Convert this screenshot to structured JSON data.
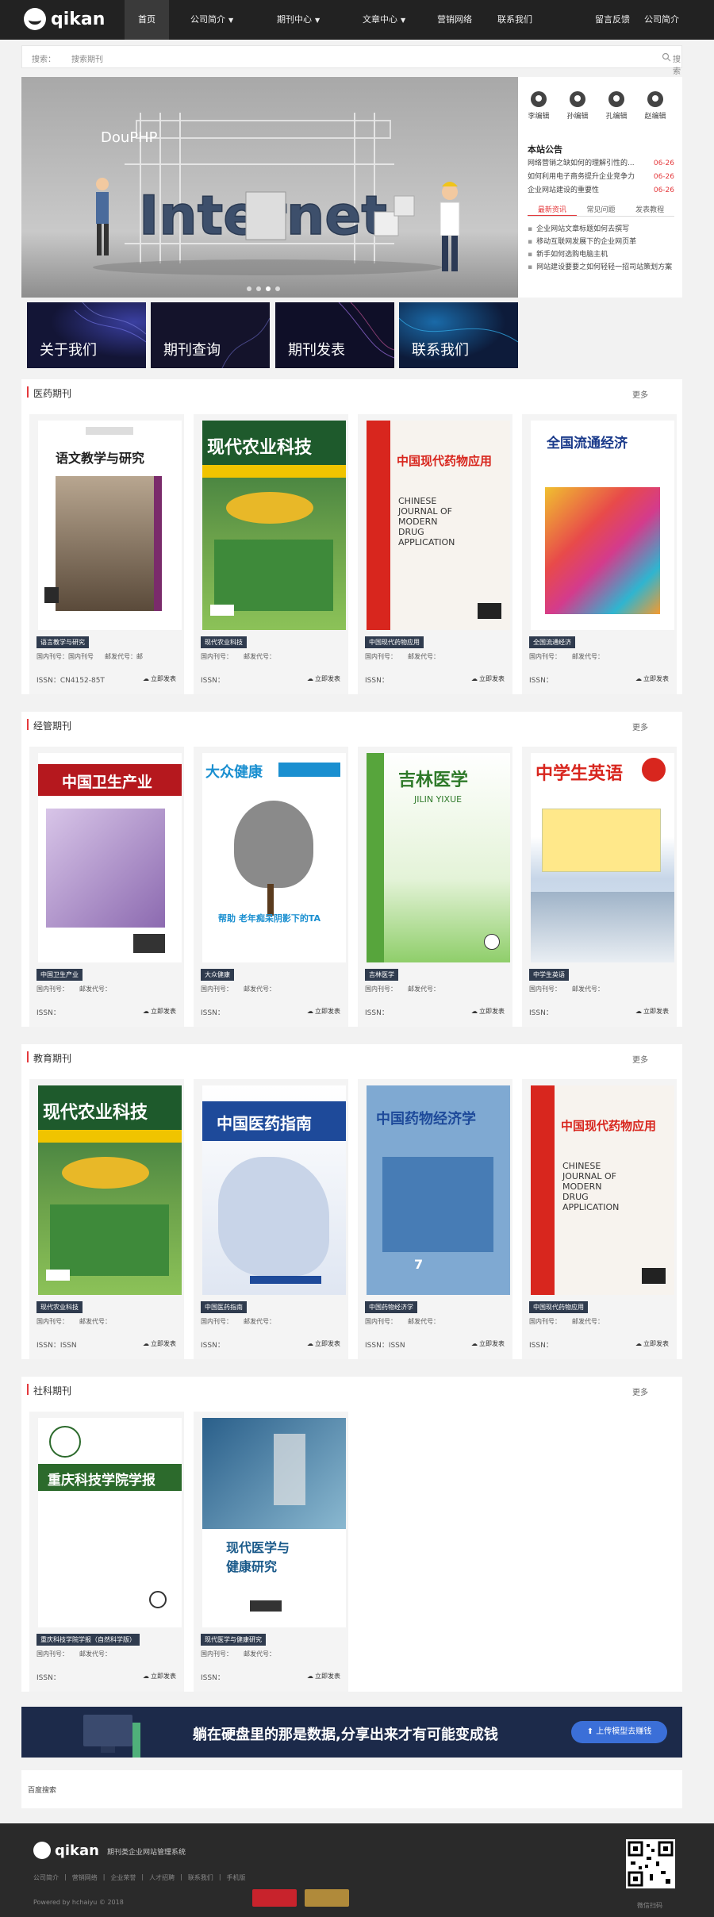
{
  "header": {
    "logo_text": "qikan",
    "nav": [
      {
        "label": "首页",
        "active": true,
        "dropdown": false
      },
      {
        "label": "公司简介",
        "active": false,
        "dropdown": true
      },
      {
        "label": "期刊中心",
        "active": false,
        "dropdown": true
      },
      {
        "label": "文章中心",
        "active": false,
        "dropdown": true
      },
      {
        "label": "营销网络",
        "active": false,
        "dropdown": false
      },
      {
        "label": "联系我们",
        "active": false,
        "dropdown": false
      }
    ],
    "right_links": [
      "留言反馈",
      "公司简介"
    ]
  },
  "search": {
    "label": "搜索：",
    "placeholder": "搜索期刊",
    "button": "搜索"
  },
  "banner": {
    "brand_text": "DouPHP",
    "headline": "Internet",
    "slides": 4,
    "active_slide": 3
  },
  "sidebar": {
    "editors": [
      "李编辑",
      "孙编辑",
      "孔编辑",
      "赵编辑"
    ],
    "notice_title": "本站公告",
    "notices": [
      {
        "text": "网络营销之缺如何的理解引性的...",
        "date": "06-26"
      },
      {
        "text": "如何利用电子商务提升企业竞争力",
        "date": "06-26"
      },
      {
        "text": "企业网站建设的重要性",
        "date": "06-26"
      }
    ],
    "tabs": [
      "最新资讯",
      "常见问题",
      "发表教程"
    ],
    "news": [
      "企业网站文章标题如何去撰写",
      "移动互联网发展下的企业网页革",
      "新手如何选购电脑主机",
      "网站建设要要之如何轻轻一招司站策划方案"
    ]
  },
  "category_tiles": [
    "关于我们",
    "期刊查询",
    "期刊发表",
    "联系我们"
  ],
  "sections": [
    {
      "title": "医药期刊",
      "more": "更多",
      "cards": [
        {
          "tag": "语言教学与研究",
          "cn_label": "国内刊号：国内刊号",
          "post_label": "邮发代号：邮",
          "issn": "ISSN：CN4152-85T",
          "cover": "yuwen"
        },
        {
          "tag": "现代农业科技",
          "cn_label": "国内刊号：",
          "post_label": "邮发代号：",
          "issn": "ISSN：",
          "cover": "nongye"
        },
        {
          "tag": "中国现代药物应用",
          "cn_label": "国内刊号：",
          "post_label": "邮发代号：",
          "issn": "ISSN：",
          "cover": "yaowu"
        },
        {
          "tag": "全国流通经济",
          "cn_label": "国内刊号：",
          "post_label": "邮发代号：",
          "issn": "ISSN：",
          "cover": "liutong"
        }
      ]
    },
    {
      "title": "经管期刊",
      "more": "更多",
      "cards": [
        {
          "tag": "中国卫生产业",
          "cn_label": "国内刊号：",
          "post_label": "邮发代号：",
          "issn": "ISSN：",
          "cover": "weisheng"
        },
        {
          "tag": "大众健康",
          "cn_label": "国内刊号：",
          "post_label": "邮发代号：",
          "issn": "ISSN：",
          "cover": "jiankang"
        },
        {
          "tag": "吉林医学",
          "cn_label": "国内刊号：",
          "post_label": "邮发代号：",
          "issn": "ISSN：",
          "cover": "jilin"
        },
        {
          "tag": "中学生英语",
          "cn_label": "国内刊号：",
          "post_label": "邮发代号：",
          "issn": "ISSN：",
          "cover": "yingyu"
        }
      ]
    },
    {
      "title": "教育期刊",
      "more": "更多",
      "cards": [
        {
          "tag": "现代农业科技",
          "cn_label": "国内刊号：",
          "post_label": "邮发代号：",
          "issn": "ISSN：ISSN",
          "cover": "nongye"
        },
        {
          "tag": "中国医药指南",
          "cn_label": "国内刊号：",
          "post_label": "邮发代号：",
          "issn": "ISSN：",
          "cover": "zhinan"
        },
        {
          "tag": "中国药物经济学",
          "cn_label": "国内刊号：",
          "post_label": "邮发代号：",
          "issn": "ISSN：ISSN",
          "cover": "jingji"
        },
        {
          "tag": "中国现代药物应用",
          "cn_label": "国内刊号：",
          "post_label": "邮发代号：",
          "issn": "ISSN：",
          "cover": "yaowu"
        }
      ]
    },
    {
      "title": "社科期刊",
      "more": "更多",
      "cards": [
        {
          "tag": "重庆科技学院学报（自然科学版）",
          "cn_label": "国内刊号：",
          "post_label": "邮发代号：",
          "issn": "ISSN：",
          "cover": "chongqing"
        },
        {
          "tag": "现代医学与健康研究",
          "cn_label": "国内刊号：",
          "post_label": "邮发代号：",
          "issn": "ISSN：",
          "cover": "yixue"
        }
      ]
    }
  ],
  "card_action": "立即发表",
  "ad": {
    "text": "躺在硬盘里的那是数据,分享出来才有可能变成钱",
    "button": "上传模型去赚钱"
  },
  "links": {
    "title": "百度搜索"
  },
  "footer": {
    "logo_text": "qikan",
    "slogan": "期刊类企业网站管理系统",
    "links": [
      "公司简介",
      "营销网络",
      "企业荣誉",
      "人才招聘",
      "联系我们",
      "手机版"
    ],
    "powered": "Powered by hchaiyu © 2018",
    "qr_label": "微信扫码"
  },
  "colors": {
    "accent": "#e4393c",
    "header_bg": "#222222",
    "tag_bg": "#2f3b4e",
    "ad_bg": "#1c2a4a"
  }
}
